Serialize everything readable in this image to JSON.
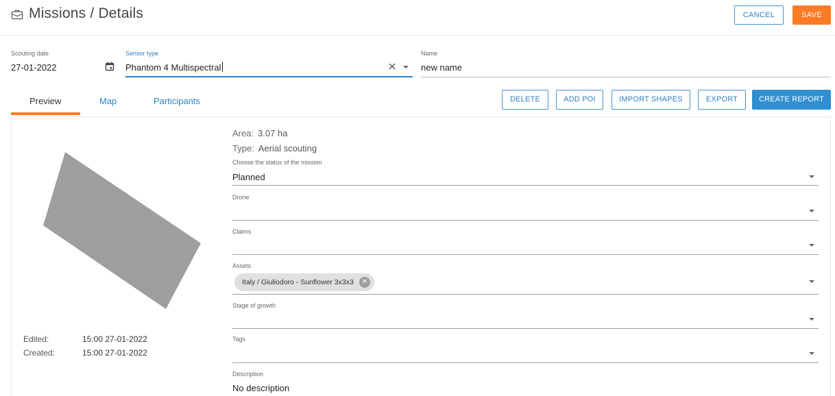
{
  "header": {
    "title_section": "Missions",
    "title_separator": "/",
    "title_page": "Details",
    "cancel_label": "CANCEL",
    "save_label": "SAVE"
  },
  "form": {
    "scouting_date": {
      "label": "Scouting date",
      "value": "27-01-2022"
    },
    "sensor_type": {
      "label": "Sensor type",
      "value": "Phantom 4 Multispectral"
    },
    "name": {
      "label": "Name",
      "value": "new name"
    }
  },
  "tabs": [
    {
      "label": "Preview",
      "active": true
    },
    {
      "label": "Map",
      "active": false
    },
    {
      "label": "Participants",
      "active": false
    }
  ],
  "actions": {
    "delete": "DELETE",
    "add_poi": "ADD POI",
    "import_shapes": "IMPORT SHAPES",
    "export": "EXPORT",
    "create_report": "CREATE REPORT"
  },
  "preview": {
    "edited_label": "Edited:",
    "edited_value": "15:00 27-01-2022",
    "created_label": "Created:",
    "created_value": "15:00 27-01-2022"
  },
  "details": {
    "area_label": "Area:",
    "area_value": "3.07 ha",
    "type_label": "Type:",
    "type_value": "Aerial scouting",
    "status": {
      "label": "Choose the status of the mission",
      "value": "Planned"
    },
    "drone": {
      "label": "Drone",
      "value": ""
    },
    "claims": {
      "label": "Claims",
      "value": ""
    },
    "assets": {
      "label": "Assets",
      "chips": [
        "Italy / Giuliodoro - Sunflower 3x3x3"
      ]
    },
    "stage_of_growth": {
      "label": "Stage of growth",
      "value": ""
    },
    "tags": {
      "label": "Tags",
      "value": ""
    },
    "description": {
      "label": "Description",
      "value": "No description"
    }
  },
  "colors": {
    "accent_orange": "#ff7b24",
    "primary_blue": "#2f8fd0",
    "shape_gray": "#9e9e9e"
  }
}
